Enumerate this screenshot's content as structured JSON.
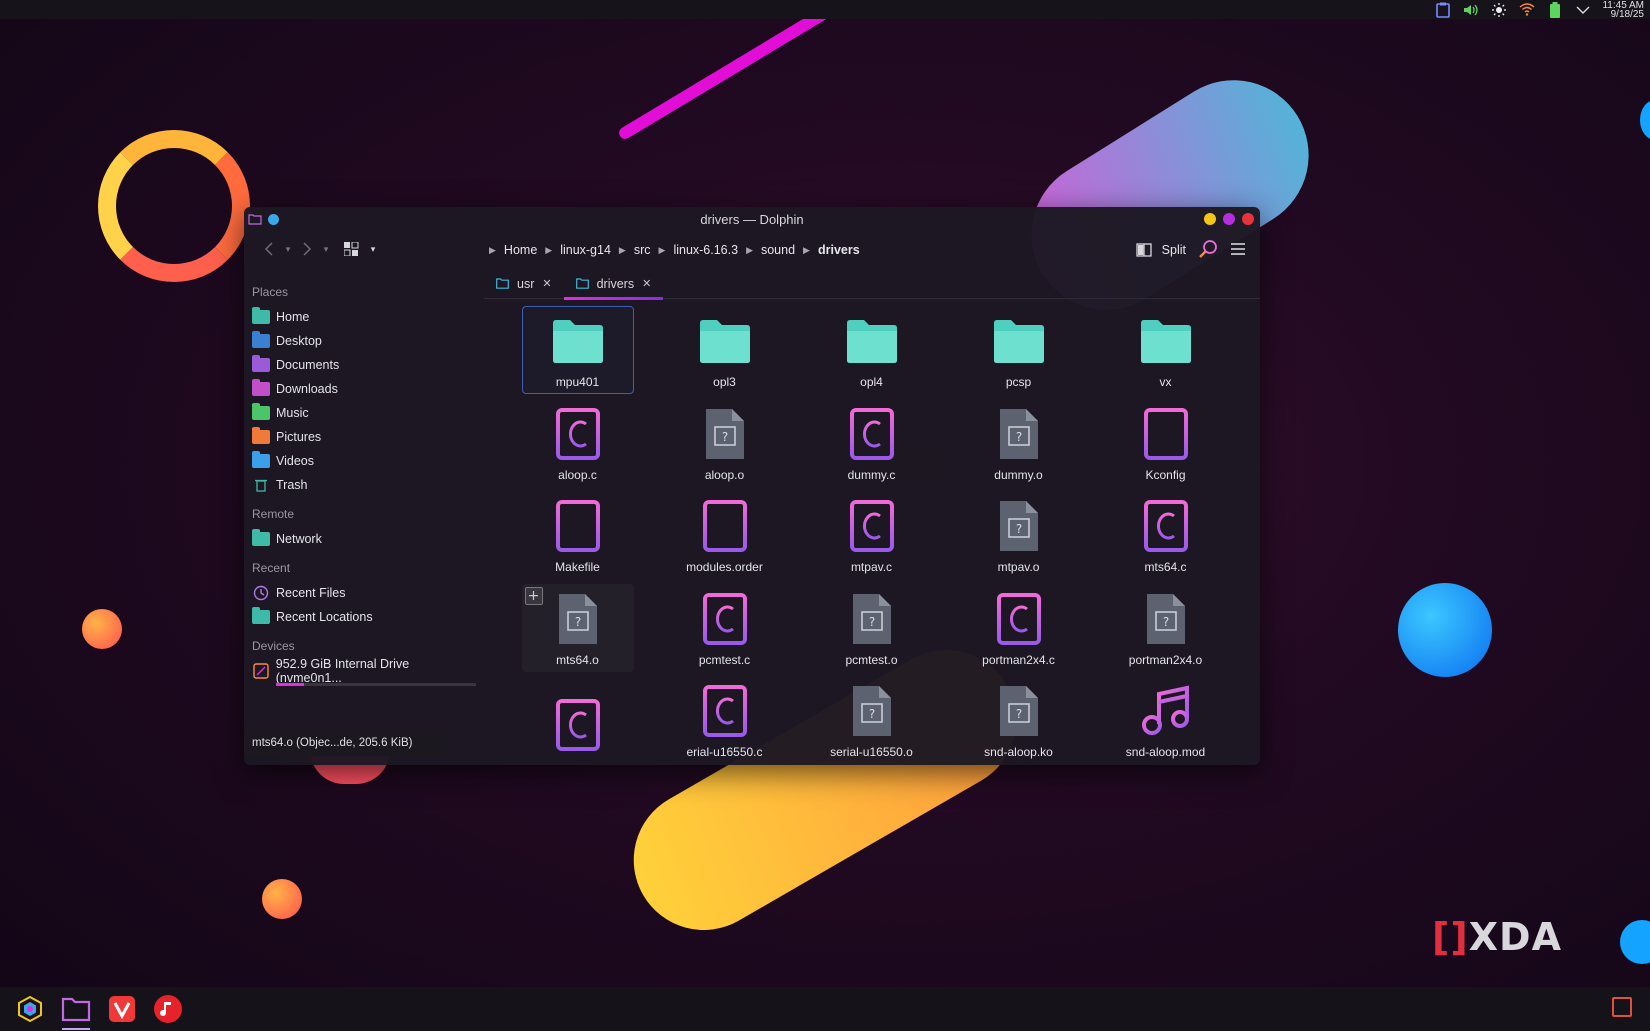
{
  "topbar": {
    "tray_icons": [
      "clipboard-icon",
      "volume-icon",
      "brightness-icon",
      "wifi-icon",
      "battery-icon",
      "chevron-down-icon"
    ],
    "time": "11:45 AM",
    "date": "9/18/25"
  },
  "window": {
    "title": "drivers — Dolphin",
    "colors": {
      "minimize": "#f5c518",
      "maximize": "#b62ee0",
      "close": "#e8323c"
    }
  },
  "toolbar": {
    "breadcrumbs": [
      "Home",
      "linux-g14",
      "src",
      "linux-6.16.3",
      "sound",
      "drivers"
    ],
    "split_label": "Split"
  },
  "sidebar": {
    "places_title": "Places",
    "places": [
      {
        "label": "Home",
        "color": "#3fb9a8"
      },
      {
        "label": "Desktop",
        "color": "#3b7fd0"
      },
      {
        "label": "Documents",
        "color": "#9b5ad8"
      },
      {
        "label": "Downloads",
        "color": "#c04fc8"
      },
      {
        "label": "Music",
        "color": "#4cc46a"
      },
      {
        "label": "Pictures",
        "color": "#f07a3a"
      },
      {
        "label": "Videos",
        "color": "#3aa0e8"
      },
      {
        "label": "Trash",
        "color": "#3fb9a8"
      }
    ],
    "remote_title": "Remote",
    "remote": [
      {
        "label": "Network"
      }
    ],
    "recent_title": "Recent",
    "recent": [
      {
        "label": "Recent Files"
      },
      {
        "label": "Recent Locations"
      }
    ],
    "devices_title": "Devices",
    "devices": [
      {
        "label": "952.9 GiB Internal Drive (nvme0n1...",
        "usage_fraction": 0.14
      }
    ]
  },
  "tabs": [
    {
      "label": "usr"
    },
    {
      "label": "drivers",
      "active": true
    }
  ],
  "files": [
    {
      "name": "mpu401",
      "type": "folder",
      "selected": true
    },
    {
      "name": "opl3",
      "type": "folder"
    },
    {
      "name": "opl4",
      "type": "folder"
    },
    {
      "name": "pcsp",
      "type": "folder"
    },
    {
      "name": "vx",
      "type": "folder"
    },
    {
      "name": "aloop.c",
      "type": "c"
    },
    {
      "name": "aloop.o",
      "type": "unknown"
    },
    {
      "name": "dummy.c",
      "type": "c"
    },
    {
      "name": "dummy.o",
      "type": "unknown"
    },
    {
      "name": "Kconfig",
      "type": "text"
    },
    {
      "name": "Makefile",
      "type": "text"
    },
    {
      "name": "modules.order",
      "type": "text"
    },
    {
      "name": "mtpav.c",
      "type": "c"
    },
    {
      "name": "mtpav.o",
      "type": "unknown"
    },
    {
      "name": "mts64.c",
      "type": "c"
    },
    {
      "name": "mts64.o",
      "type": "unknown",
      "hover": true
    },
    {
      "name": "pcmtest.c",
      "type": "c"
    },
    {
      "name": "pcmtest.o",
      "type": "unknown"
    },
    {
      "name": "portman2x4.c",
      "type": "c"
    },
    {
      "name": "portman2x4.o",
      "type": "unknown"
    },
    {
      "name": "",
      "type": "c"
    },
    {
      "name": "erial-u16550.c",
      "type": "c"
    },
    {
      "name": "serial-u16550.o",
      "type": "unknown"
    },
    {
      "name": "snd-aloop.ko",
      "type": "unknown"
    },
    {
      "name": "snd-aloop.mod",
      "type": "music"
    }
  ],
  "tooltip": "mts64.o (Objec...de, 205.6 KiB)",
  "taskbar": {
    "apps": [
      "app-launcher-icon",
      "dolphin-icon",
      "vivaldi-icon",
      "music-app-icon"
    ]
  },
  "watermark": {
    "bracket": "[]",
    "text": "XDA"
  }
}
